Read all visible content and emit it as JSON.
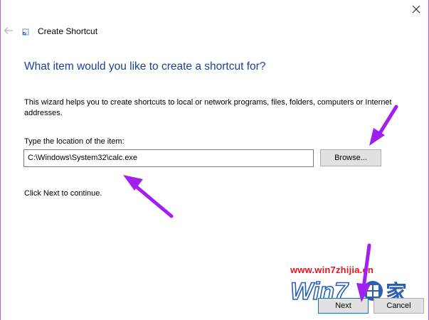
{
  "window": {
    "title": "Create Shortcut"
  },
  "wizard": {
    "heading": "What item would you like to create a shortcut for?",
    "description": "This wizard helps you to create shortcuts to local or network programs, files, folders, computers or Internet addresses.",
    "location_label": "Type the location of the item:",
    "location_value": "C:\\Windows\\System32\\calc.exe",
    "browse_label": "Browse...",
    "continue_text": "Click Next to continue."
  },
  "footer": {
    "next_label": "Next",
    "cancel_label": "Cancel"
  },
  "watermark": {
    "url": "www.win7zhijia.cn",
    "logo_text": "Win7",
    "logo_char": "家"
  },
  "colors": {
    "heading": "#1f3f99",
    "arrow": "#a020f0",
    "watermark": "#e8141a",
    "logo_blue": "#2a5fb3"
  },
  "icons": {
    "close": "close-icon",
    "back": "back-arrow-icon",
    "title": "shortcut-icon"
  }
}
